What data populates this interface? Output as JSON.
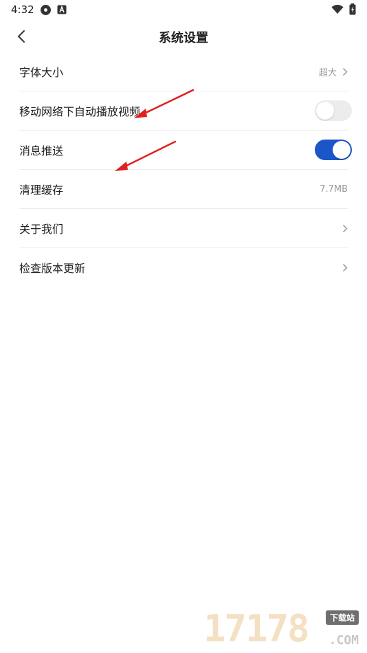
{
  "status_bar": {
    "time": "4:32",
    "icons_left": [
      "settings-icon",
      "notification-a-icon"
    ],
    "icons_right": [
      "wifi-icon",
      "battery-icon"
    ]
  },
  "header": {
    "title": "系统设置",
    "back_icon": "chevron-left-icon"
  },
  "settings": [
    {
      "label": "字体大小",
      "value": "超大",
      "control": "chevron"
    },
    {
      "label": "移动网络下自动播放视频",
      "control": "toggle",
      "state": "off"
    },
    {
      "label": "消息推送",
      "control": "toggle",
      "state": "on"
    },
    {
      "label": "清理缓存",
      "value": "7.7MB",
      "control": "value"
    },
    {
      "label": "关于我们",
      "control": "chevron"
    },
    {
      "label": "检查版本更新",
      "control": "chevron"
    }
  ],
  "colors": {
    "toggle_on": "#1a56c7",
    "toggle_off": "#ececec",
    "annotation_arrow": "#e0201c"
  },
  "watermark": {
    "digits": "17178",
    "badge": "下载站",
    "suffix": ".COM"
  }
}
